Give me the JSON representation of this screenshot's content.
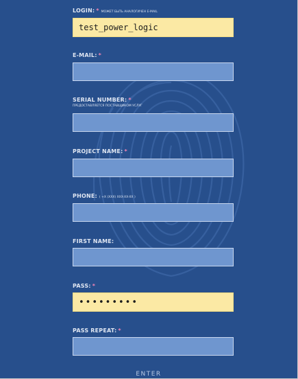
{
  "fields": {
    "login": {
      "label": "LOGIN:",
      "required": "*",
      "note": "МОЖЕТ БЫТЬ АНАЛОГИЧЕН E-MAIL",
      "value": "test_power_logic"
    },
    "email": {
      "label": "E-MAIL:",
      "required": "*",
      "value": ""
    },
    "serial": {
      "label": "SERIAL NUMBER:",
      "required": "*",
      "note": "ПРЕДОСТАВЛЯЕТСЯ ПОСТАВЩИКОМ УСЛУГ",
      "value": ""
    },
    "project": {
      "label": "PROJECT NAME:",
      "required": "*",
      "value": ""
    },
    "phone": {
      "label": "PHONE:",
      "note": "( +X (XXX) XXX-XX-XX )",
      "value": ""
    },
    "first_name": {
      "label": "FIRST NAME:",
      "value": ""
    },
    "pass": {
      "label": "PASS:",
      "required": "*",
      "value": "•••••••••"
    },
    "pass_repeat": {
      "label": "PASS REPEAT:",
      "required": "*",
      "value": ""
    }
  },
  "submit": {
    "label": "ENTER"
  },
  "colors": {
    "background": "#274f8c",
    "input_empty": "#6f96cf",
    "input_filled": "#fbe9a4",
    "required_mark": "#f084b4"
  },
  "icons": {
    "background": "fingerprint-icon"
  }
}
